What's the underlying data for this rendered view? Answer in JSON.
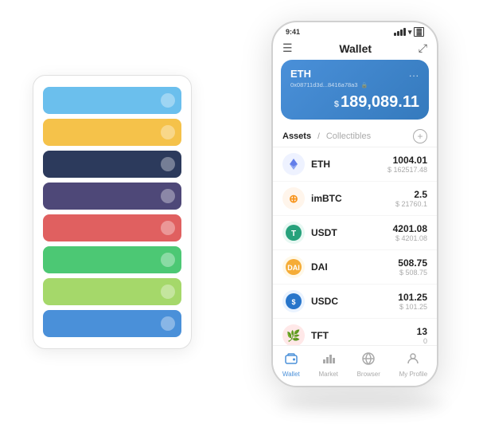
{
  "header": {
    "title": "Wallet",
    "time": "9:41",
    "menu_icon": "☰",
    "expand_icon": "⤢"
  },
  "eth_card": {
    "title": "ETH",
    "more": "...",
    "address": "0x08711d3d...8416a78a3",
    "lock_symbol": "🔒",
    "currency_symbol": "$",
    "balance": "189,089.11"
  },
  "assets": {
    "tab_active": "Assets",
    "tab_sep": "/",
    "tab_inactive": "Collectibles",
    "add_label": "+"
  },
  "asset_list": [
    {
      "symbol": "ETH",
      "icon": "♦",
      "icon_color": "#627EEA",
      "amount": "1004.01",
      "usd": "$ 162517.48"
    },
    {
      "symbol": "imBTC",
      "icon": "⊕",
      "icon_color": "#F7931A",
      "amount": "2.5",
      "usd": "$ 21760.1"
    },
    {
      "symbol": "USDT",
      "icon": "T",
      "icon_color": "#26A17B",
      "amount": "4201.08",
      "usd": "$ 4201.08"
    },
    {
      "symbol": "DAI",
      "icon": "◎",
      "icon_color": "#F5AC37",
      "amount": "508.75",
      "usd": "$ 508.75"
    },
    {
      "symbol": "USDC",
      "icon": "$",
      "icon_color": "#2775CA",
      "amount": "101.25",
      "usd": "$ 101.25"
    },
    {
      "symbol": "TFT",
      "icon": "🌿",
      "icon_color": "#E8424A",
      "amount": "13",
      "usd": "0"
    }
  ],
  "bottom_nav": [
    {
      "label": "Wallet",
      "icon": "◎",
      "active": true
    },
    {
      "label": "Market",
      "icon": "📊",
      "active": false
    },
    {
      "label": "Browser",
      "icon": "👤",
      "active": false
    },
    {
      "label": "My Profile",
      "icon": "👤",
      "active": false
    }
  ],
  "card_stack": [
    {
      "color": "#6BBFED"
    },
    {
      "color": "#F5C24A"
    },
    {
      "color": "#2C3A5C"
    },
    {
      "color": "#4E4878"
    },
    {
      "color": "#E06060"
    },
    {
      "color": "#4CC874"
    },
    {
      "color": "#A5D86A"
    },
    {
      "color": "#4A90D9"
    }
  ]
}
